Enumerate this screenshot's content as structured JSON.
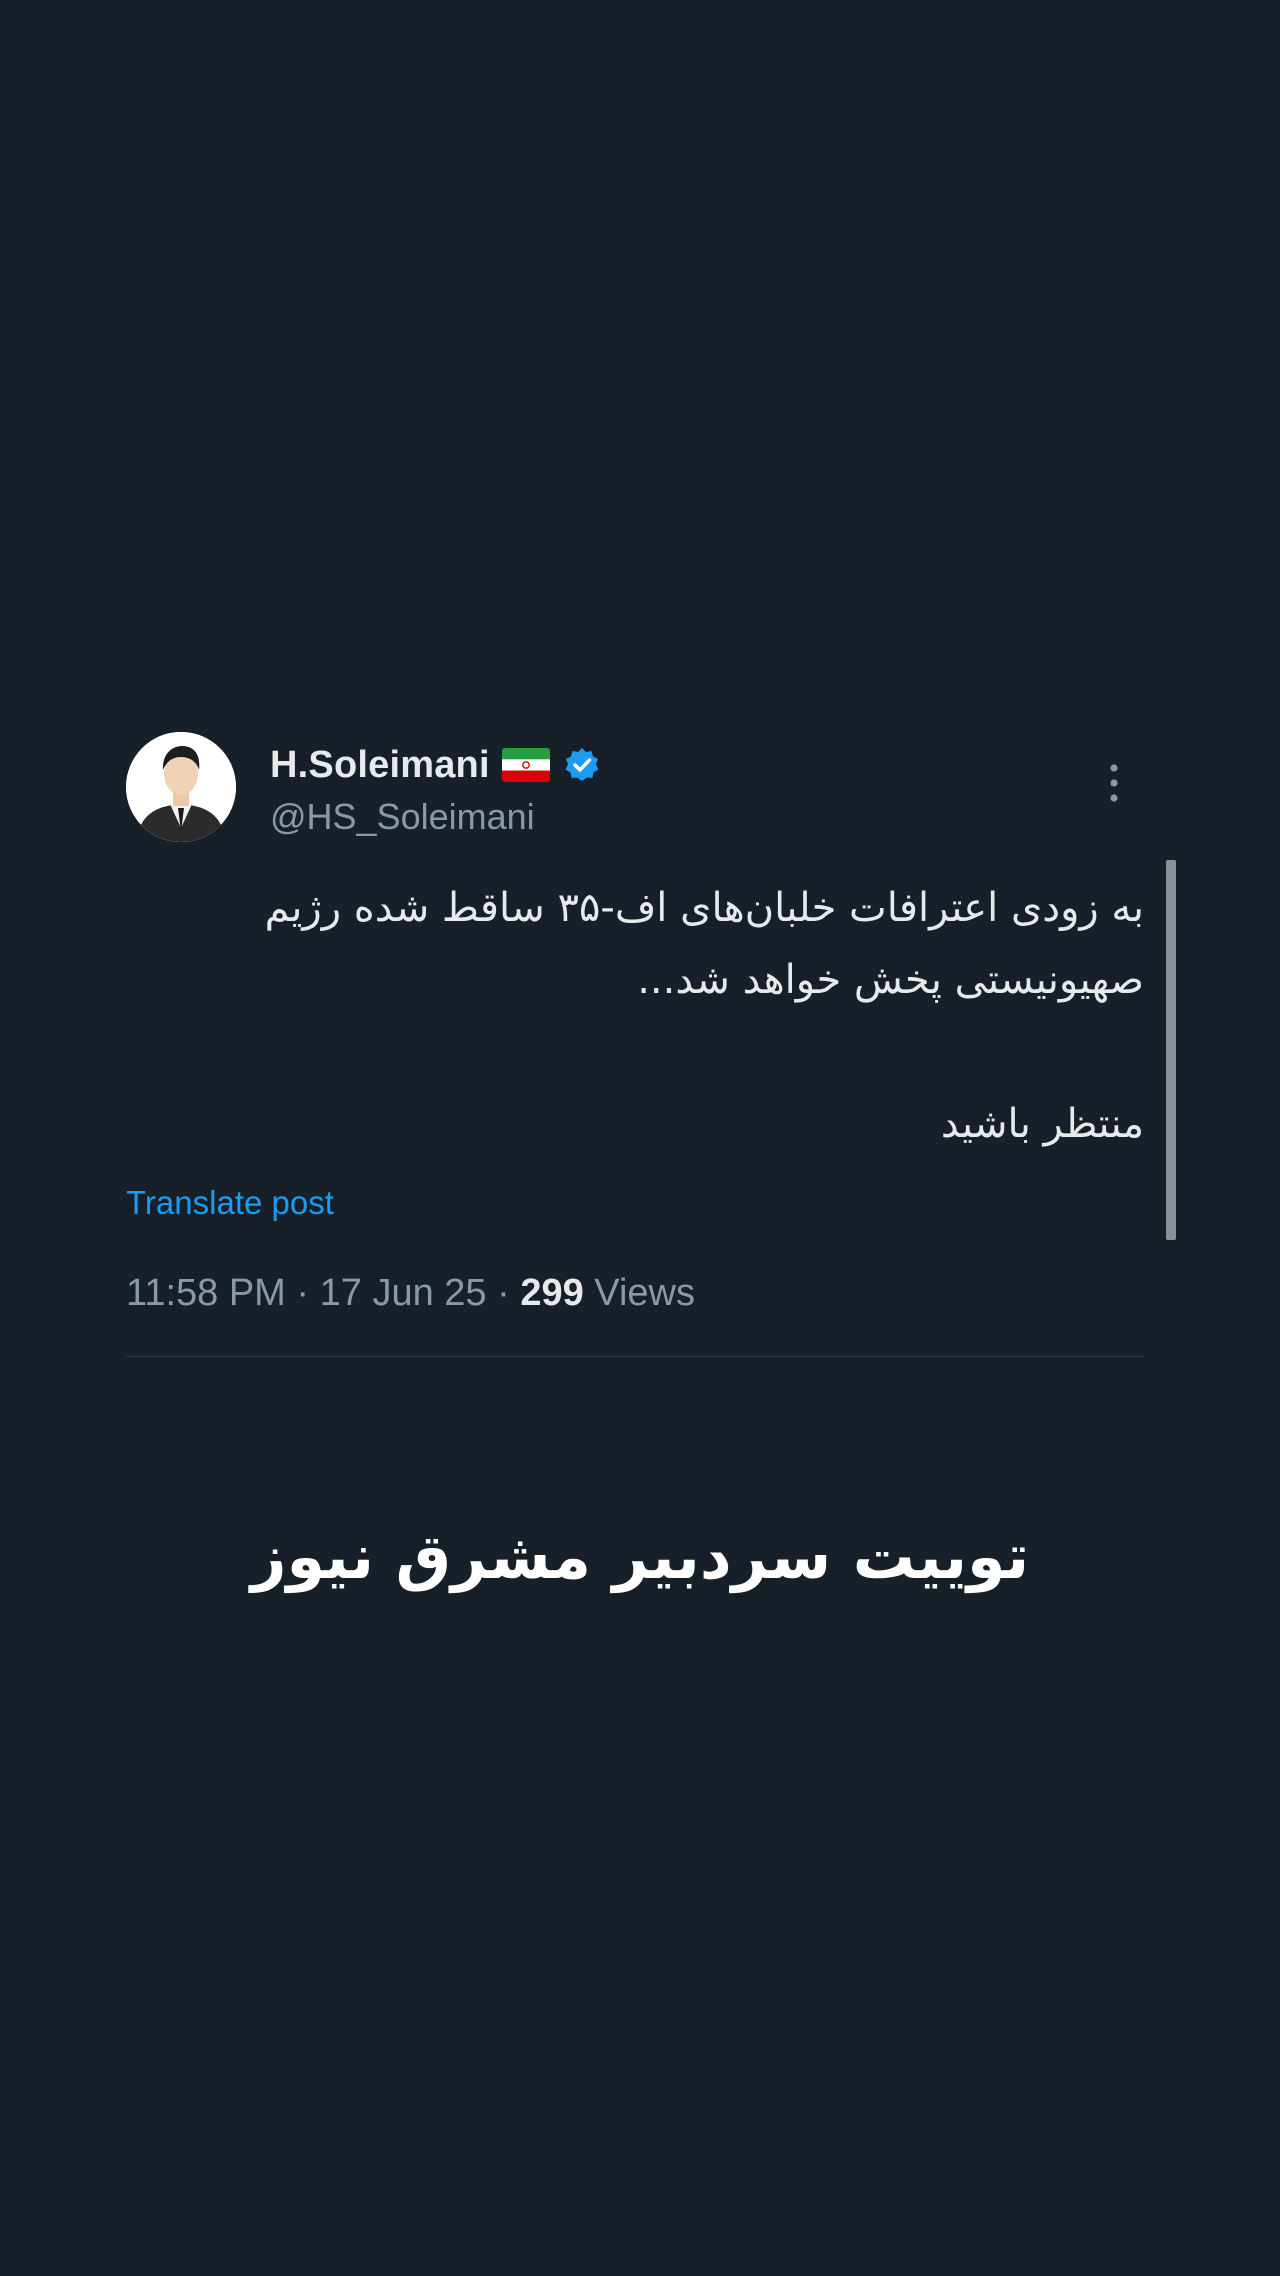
{
  "tweet": {
    "display_name": "H.Soleimani",
    "handle": "@HS_Soleimani",
    "flag_icon": "iran-flag-icon",
    "verified_icon": "verified-badge-icon",
    "more_icon": "more-options-icon",
    "body_line_1": "به زودی اعترافات خلبان‌های اف-۳۵ ساقط شده رژیم صهیونیستی پخش خواهد شد...",
    "body_line_2": "منتظر باشید",
    "translate_label": "Translate post",
    "time": "11:58 PM",
    "date": "17 Jun 25",
    "views_count": "299",
    "views_label": "Views",
    "separator": "·"
  },
  "caption": "توییت سردبیر مشرق نیوز",
  "colors": {
    "background": "#171f29",
    "text_primary": "#e7e9ea",
    "text_secondary": "#8b98a5",
    "link": "#1d9bf0",
    "verified": "#1d9bf0"
  }
}
